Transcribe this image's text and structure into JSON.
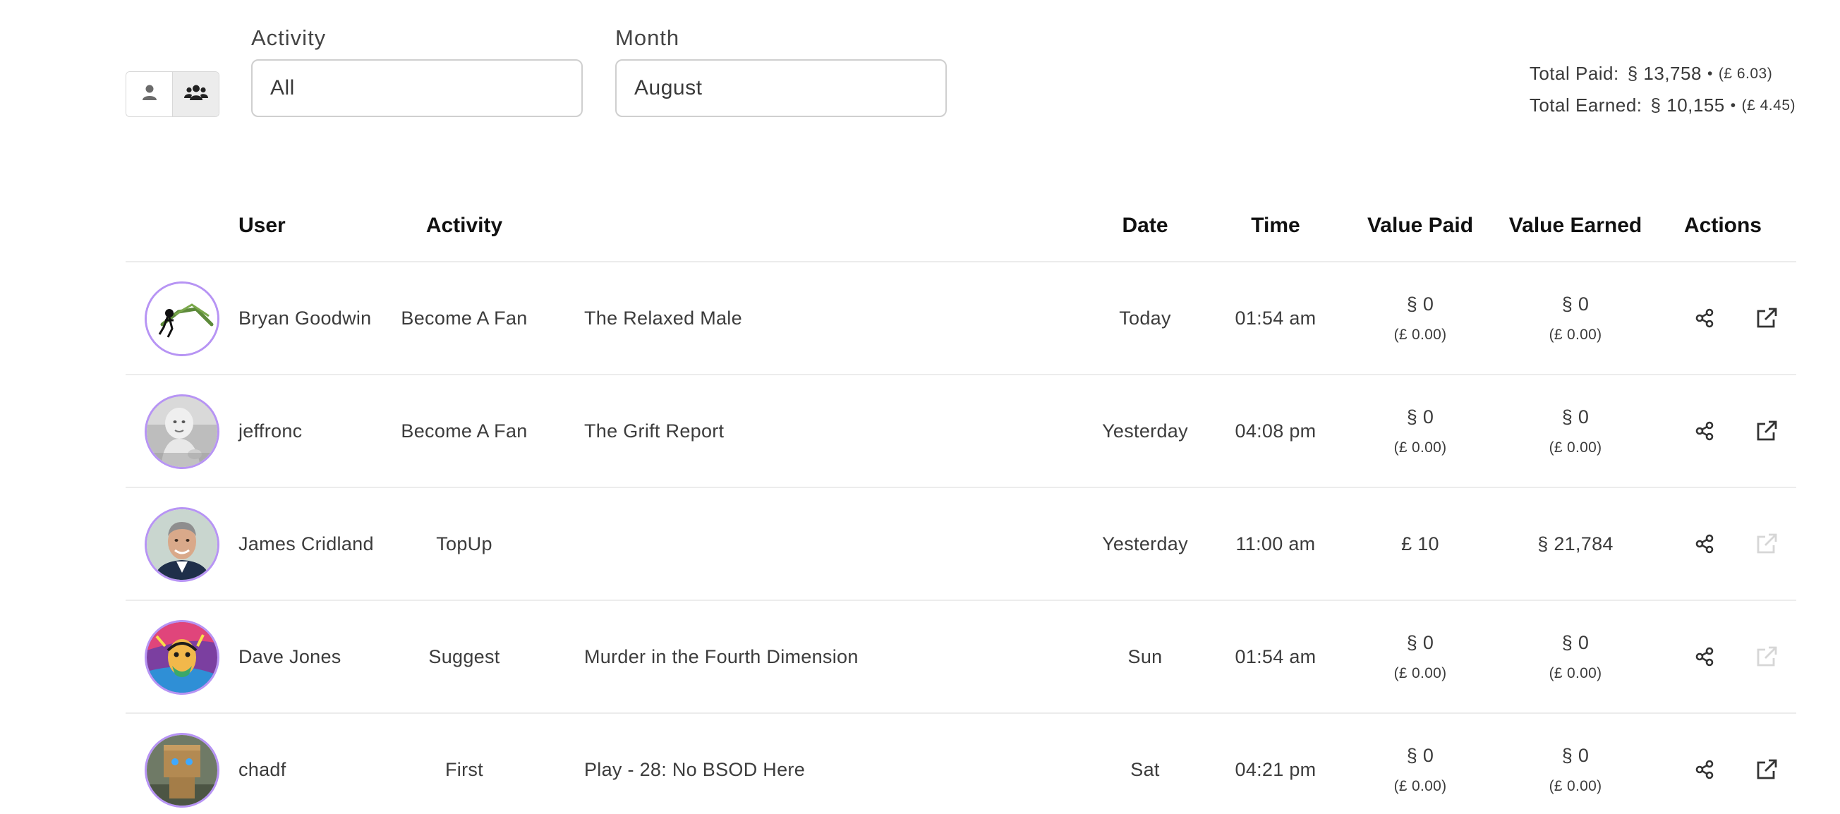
{
  "filters": {
    "activity_label": "Activity",
    "activity_value": "All",
    "month_label": "Month",
    "month_value": "August"
  },
  "totals": {
    "paid_label": "Total Paid:",
    "paid_value": "§ 13,758",
    "paid_sep": "•",
    "paid_fiat": "(£ 6.03)",
    "earned_label": "Total Earned:",
    "earned_value": "§ 10,155",
    "earned_sep": "•",
    "earned_fiat": "(£ 4.45)"
  },
  "table": {
    "headers": {
      "user": "User",
      "activity": "Activity",
      "date": "Date",
      "time": "Time",
      "value_paid": "Value Paid",
      "value_earned": "Value Earned",
      "actions": "Actions"
    },
    "rows": [
      {
        "user_name": "Bryan Goodwin",
        "activity": "Become A Fan",
        "description": "The Relaxed Male",
        "date": "Today",
        "time": "01:54 am",
        "paid_main": "§ 0",
        "paid_sub": "(£ 0.00)",
        "earned_main": "§ 0",
        "earned_sub": "(£ 0.00)",
        "avatar_icon": "mantis-avatar",
        "open_enabled": true
      },
      {
        "user_name": "jeffronc",
        "activity": "Become A Fan",
        "description": "The Grift Report",
        "date": "Yesterday",
        "time": "04:08 pm",
        "paid_main": "§ 0",
        "paid_sub": "(£ 0.00)",
        "earned_main": "§ 0",
        "earned_sub": "(£ 0.00)",
        "avatar_icon": "baby-photo-avatar",
        "open_enabled": true
      },
      {
        "user_name": "James Cridland",
        "activity": "TopUp",
        "description": "",
        "date": "Yesterday",
        "time": "11:00 am",
        "paid_main": "£ 10",
        "paid_sub": "",
        "earned_main": "§ 21,784",
        "earned_sub": "",
        "avatar_icon": "man-portrait-avatar",
        "open_enabled": false
      },
      {
        "user_name": "Dave Jones",
        "activity": "Suggest",
        "description": "Murder in the Fourth Dimension",
        "date": "Sun",
        "time": "01:54 am",
        "paid_main": "§ 0",
        "paid_sub": "(£ 0.00)",
        "earned_main": "§ 0",
        "earned_sub": "(£ 0.00)",
        "avatar_icon": "colorful-art-avatar",
        "open_enabled": false
      },
      {
        "user_name": "chadf",
        "activity": "First",
        "description": "Play - 28: No BSOD Here",
        "date": "Sat",
        "time": "04:21 pm",
        "paid_main": "§ 0",
        "paid_sub": "(£ 0.00)",
        "earned_main": "§ 0",
        "earned_sub": "(£ 0.00)",
        "avatar_icon": "robot-box-avatar",
        "open_enabled": true
      }
    ]
  },
  "colors": {
    "avatar_ring": "#b794f4",
    "icon_active": "#333333",
    "icon_disabled": "#d6d6d6"
  }
}
